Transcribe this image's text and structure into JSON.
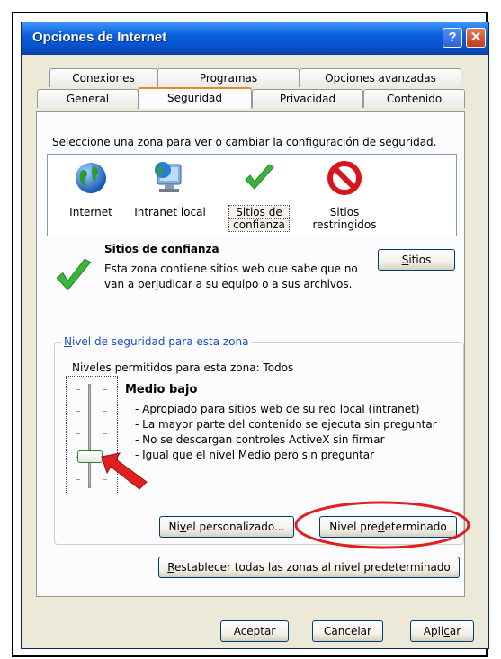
{
  "window": {
    "title": "Opciones de Internet",
    "help_glyph": "?",
    "close_glyph": "✕"
  },
  "tabs_back": [
    "Conexiones",
    "Programas",
    "Opciones avanzadas"
  ],
  "tabs_front": [
    "General",
    "Seguridad",
    "Privacidad",
    "Contenido"
  ],
  "active_tab": "Seguridad",
  "zones": {
    "prompt": "Seleccione una zona para ver o cambiar la configuración de seguridad.",
    "items": [
      {
        "label_line1": "Internet",
        "label_line2": "",
        "icon": "globe-icon"
      },
      {
        "label_line1": "Intranet local",
        "label_line2": "",
        "icon": "monitor-globe-icon"
      },
      {
        "label_line1": "Sitios de",
        "label_line2": "confianza",
        "icon": "checkmark-icon"
      },
      {
        "label_line1": "Sitios",
        "label_line2": "restringidos",
        "icon": "prohibited-icon"
      }
    ]
  },
  "zone_info": {
    "title": "Sitios de confianza",
    "desc_line1": "Esta zona contiene sitios web que sabe que no",
    "desc_line2": "van a perjudicar a su equipo o a sus archivos.",
    "sites_button": "Sitios",
    "sites_button_mnemonic": "S",
    "sites_button_rest": "itios"
  },
  "security_level": {
    "group_title_mnemonic": "N",
    "group_title_rest": "ivel de seguridad para esta zona",
    "allowed": "Niveles permitidos para esta zona: Todos",
    "level_name": "Medio bajo",
    "bullets": [
      "- Apropiado para sitios web de su red local (intranet)",
      "- La mayor parte del contenido se ejecuta sin preguntar",
      "- No se descargan controles ActiveX sin firmar",
      "- Igual que el nivel Medio pero sin preguntar"
    ],
    "slider_level": "Medio bajo",
    "custom_btn_a": "Ni",
    "custom_btn_m": "v",
    "custom_btn_b": "el personalizado...",
    "default_btn_a": "Nivel pre",
    "default_btn_m": "d",
    "default_btn_b": "eterminado"
  },
  "reset_btn_m": "R",
  "reset_btn_rest": "establecer todas las zonas al nivel predeterminado",
  "footer": {
    "ok": "Aceptar",
    "cancel": "Cancelar",
    "apply_a": "Apli",
    "apply_m": "c",
    "apply_b": "ar"
  },
  "colors": {
    "highlight": "#e02020",
    "accent": "#0a5fd8",
    "check": "#3cb43c",
    "prohibited": "#d8141c"
  }
}
